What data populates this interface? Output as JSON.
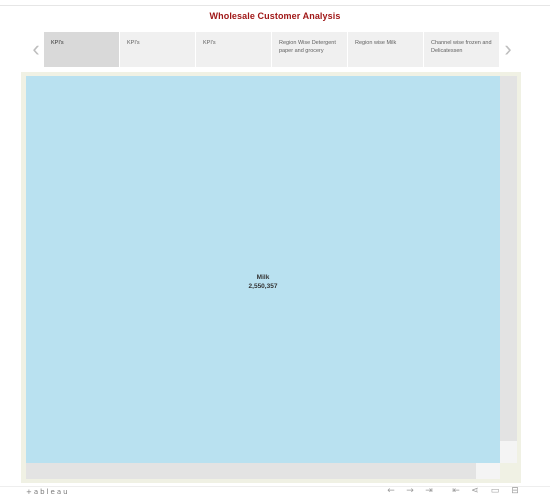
{
  "story": {
    "title": "Wholesale Customer Analysis",
    "nav_prev_icon": "chevron-left-icon",
    "nav_next_icon": "chevron-right-icon",
    "points": [
      {
        "label": "KPI's",
        "active": true
      },
      {
        "label": "KPI's",
        "active": false
      },
      {
        "label": "KPI's",
        "active": false
      },
      {
        "label": "Region Wise Detergent paper and grocery",
        "active": false
      },
      {
        "label": "Region wise Milk",
        "active": false
      },
      {
        "label": "Channel wise frozen and Delicatessen",
        "active": false
      }
    ]
  },
  "viz": {
    "tile": {
      "measure": "Milk",
      "value": "2,550,357",
      "color": "#b9e1f0"
    }
  },
  "toolbar": {
    "brand": "+ableau",
    "icons": [
      "undo-icon",
      "redo-icon",
      "revert-icon",
      "refresh-icon",
      "share-icon",
      "comment-icon",
      "download-icon"
    ]
  }
}
